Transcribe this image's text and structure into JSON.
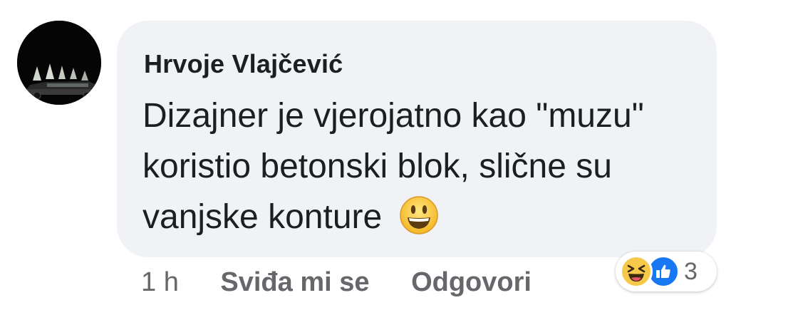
{
  "comment": {
    "author": "Hrvoje Vlajčević",
    "text": "Dizajner je vjerojatno kao \"muzu\" koristio betonski blok, slične su vanjske konture",
    "emoji": "smiley-emoji",
    "avatar_icon": "car-silhouette-avatar"
  },
  "actions": {
    "time": "1 h",
    "like_label": "Sviđa mi se",
    "reply_label": "Odgovori"
  },
  "reactions": {
    "icons": [
      "haha-reaction-icon",
      "like-reaction-icon"
    ],
    "count": "3"
  },
  "colors": {
    "bubble": "#f0f2f5",
    "text": "#1c1e21",
    "secondary": "#65676b",
    "like_blue": "#1877f2",
    "haha_yellow": "#f7c94a"
  }
}
